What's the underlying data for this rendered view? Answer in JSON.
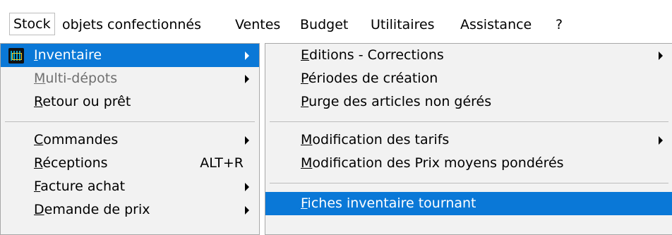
{
  "menubar": {
    "items": [
      "Stock",
      "objets confectionnés",
      "Ventes",
      "Budget",
      "Utilitaires",
      "Assistance",
      "?"
    ]
  },
  "stock_menu": {
    "items": [
      {
        "pre": "",
        "u": "I",
        "post": "nventaire",
        "shortcut": "",
        "submenu": true,
        "highlighted": true,
        "disabled": false,
        "icon": "app-icon"
      },
      {
        "pre": "",
        "u": "M",
        "post": "ulti-dépots",
        "shortcut": "",
        "submenu": true,
        "highlighted": false,
        "disabled": true
      },
      {
        "pre": "",
        "u": "R",
        "post": "etour ou prêt",
        "shortcut": "",
        "submenu": false,
        "highlighted": false,
        "disabled": false
      },
      {
        "pre": "",
        "u": "C",
        "post": "ommandes",
        "shortcut": "",
        "submenu": true,
        "highlighted": false,
        "disabled": false
      },
      {
        "pre": "",
        "u": "R",
        "post": "éceptions",
        "shortcut": "ALT+R",
        "submenu": false,
        "highlighted": false,
        "disabled": false
      },
      {
        "pre": "",
        "u": "F",
        "post": "acture achat",
        "shortcut": "",
        "submenu": true,
        "highlighted": false,
        "disabled": false
      },
      {
        "pre": "",
        "u": "D",
        "post": "emande de prix",
        "shortcut": "",
        "submenu": true,
        "highlighted": false,
        "disabled": false
      }
    ]
  },
  "inventaire_menu": {
    "items": [
      {
        "pre": "",
        "u": "E",
        "post": "ditions - Corrections",
        "submenu": true,
        "highlighted": false
      },
      {
        "pre": "",
        "u": "P",
        "post": "ériodes de création",
        "submenu": false,
        "highlighted": false
      },
      {
        "pre": "",
        "u": "P",
        "post": "urge des articles non gérés",
        "submenu": false,
        "highlighted": false
      },
      {
        "pre": "",
        "u": "M",
        "post": "odification des tarifs",
        "submenu": true,
        "highlighted": false
      },
      {
        "pre": "",
        "u": "M",
        "post": "odification des Prix moyens pondérés",
        "submenu": false,
        "highlighted": false
      },
      {
        "pre": "",
        "u": "F",
        "post": "iches inventaire tournant",
        "submenu": false,
        "highlighted": true
      }
    ]
  },
  "colors": {
    "highlight": "#0a78d7",
    "menu_bg": "#f2f2f2",
    "disabled_text": "#6f6f6f"
  }
}
